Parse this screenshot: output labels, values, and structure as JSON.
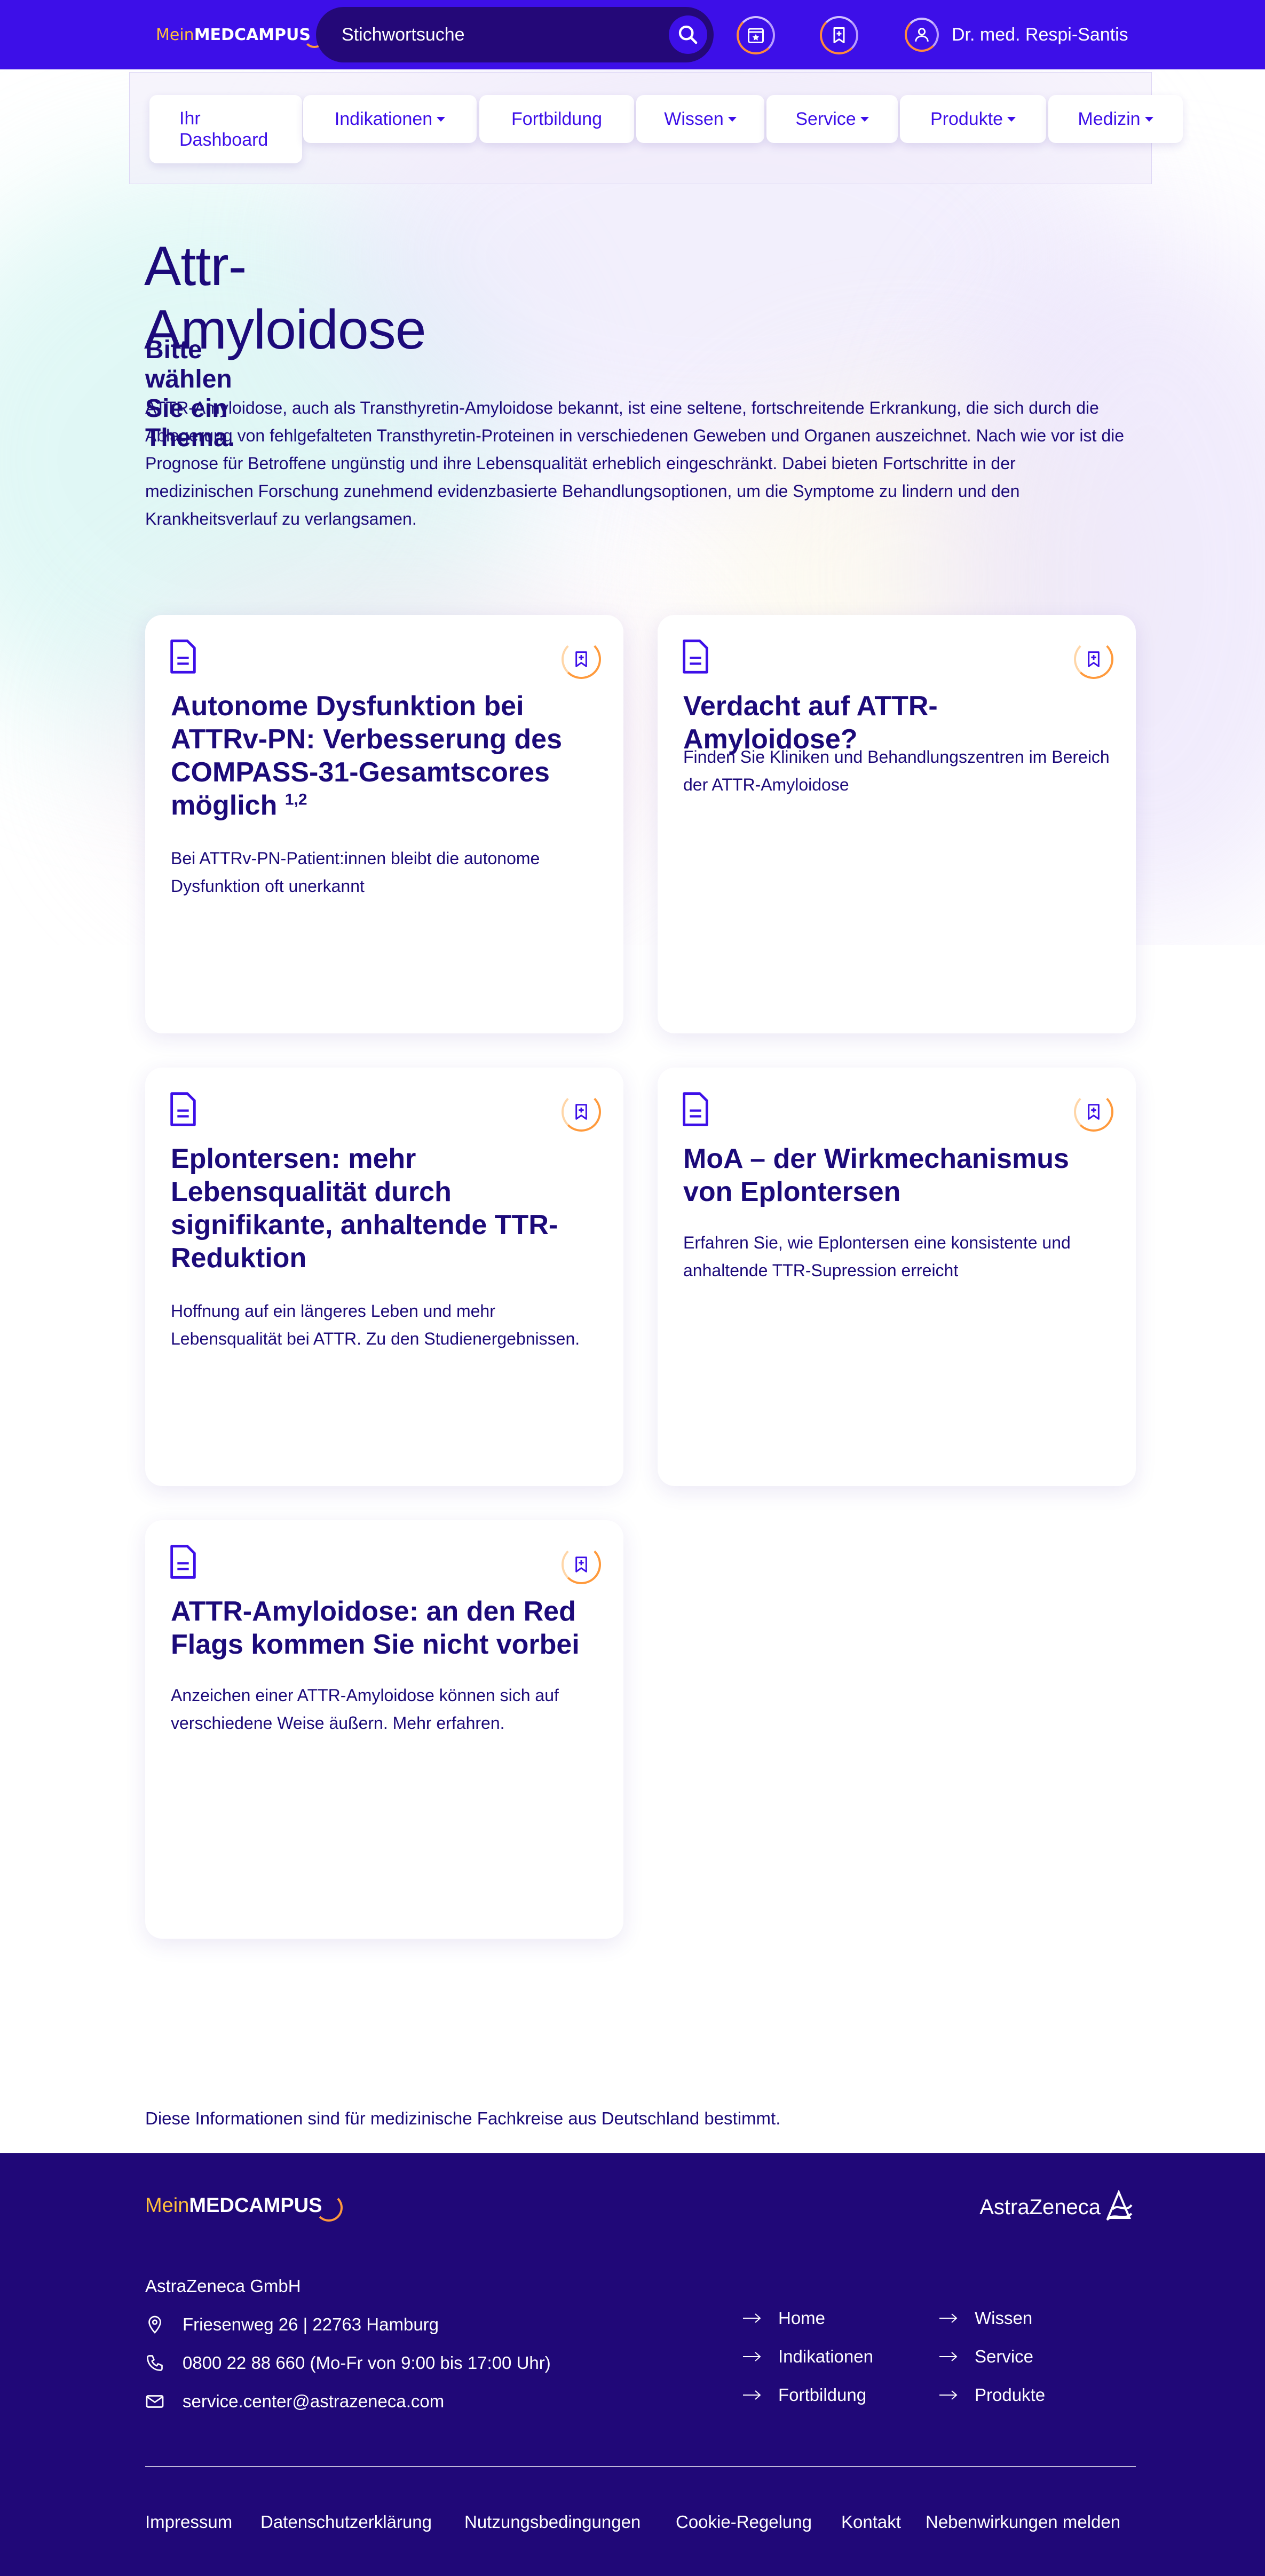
{
  "header": {
    "logo_prefix": "Mein",
    "logo_main": "MEDCAMPUS",
    "search_placeholder": "Stichwortsuche",
    "user_name": "Dr. med. Respi-Santis"
  },
  "nav": {
    "items": [
      {
        "label": "Ihr Dashboard"
      },
      {
        "label": "Indikationen"
      },
      {
        "label": "Fortbildung"
      },
      {
        "label": "Wissen"
      },
      {
        "label": "Service"
      },
      {
        "label": "Produkte"
      },
      {
        "label": "Medizin"
      }
    ]
  },
  "page": {
    "title": "Attr-Amyloidose",
    "subtitle": "Bitte wählen Sie ein Thema.",
    "intro": "ATTR-Amyloidose, auch als Transthyretin-Amyloidose bekannt, ist eine seltene, fortschreitende Erkrankung, die sich durch die Ablagerung von fehlgefalteten Transthyretin-Proteinen in verschiedenen Geweben und Organen auszeichnet. Nach wie vor ist die Prognose für Betroffene ungünstig und ihre Lebensqualität erheblich eingeschränkt. Dabei bieten Fortschritte in der medizinischen Forschung zunehmend evidenzbasierte Behandlungsoptionen, um die Symptome zu lindern und den Krankheitsverlauf zu verlangsamen."
  },
  "cards": [
    {
      "title": "Autonome Dysfunktion bei ATTRv-PN: Verbesserung des COMPASS-31-Gesamtscores möglich",
      "superscript": "1,2",
      "text": "Bei ATTRv-PN-Patient:innen bleibt die autonome Dysfunktion oft unerkannt"
    },
    {
      "title": "Verdacht auf ATTR-Amyloidose?",
      "superscript": "",
      "text": "Finden Sie Kliniken und Behandlungszentren im Bereich der ATTR-Amyloidose"
    },
    {
      "title": "Eplontersen: mehr Lebensqualität durch signifikante, anhaltende TTR-Reduktion",
      "superscript": "",
      "text": "Hoffnung auf ein längeres Leben und mehr Lebensqualität bei ATTR. Zu den Studienergebnissen."
    },
    {
      "title": "MoA – der Wirkmechanismus von Eplontersen",
      "superscript": "",
      "text": "Erfahren Sie, wie Eplontersen eine konsistente und anhaltende TTR-Supression erreicht"
    },
    {
      "title": "ATTR-Amyloidose: an den Red Flags kommen Sie nicht vorbei",
      "superscript": "",
      "text": "Anzeichen einer ATTR-Amyloidose können sich auf verschiedene Weise äußern. Mehr erfahren."
    }
  ],
  "footer": {
    "disclaimer": "Diese Informationen sind für medizinische Fachkreise aus Deutschland bestimmt.",
    "logo_prefix": "Mein",
    "logo_main": "MEDCAMPUS",
    "partner_logo": "AstraZeneca",
    "company": "AstraZeneca GmbH",
    "address": "Friesenweg 26 | 22763 Hamburg",
    "phone": "0800 22 88 660 (Mo-Fr von 9:00 bis 17:00 Uhr)",
    "email": "service.center@astrazeneca.com",
    "links_col1": [
      "Home",
      "Indikationen",
      "Fortbildung"
    ],
    "links_col2": [
      "Wissen",
      "Service",
      "Produkte"
    ],
    "bottom_links": [
      "Impressum",
      "Datenschutzerklärung",
      "Nutzungsbedingungen",
      "Cookie-Regelung",
      "Kontakt",
      "Nebenwirkungen melden"
    ]
  },
  "colors": {
    "brand_primary": "#3d0fe8",
    "brand_dark": "#200878",
    "accent_orange": "#ff9a3c",
    "text_dark": "#1c0a7a"
  }
}
